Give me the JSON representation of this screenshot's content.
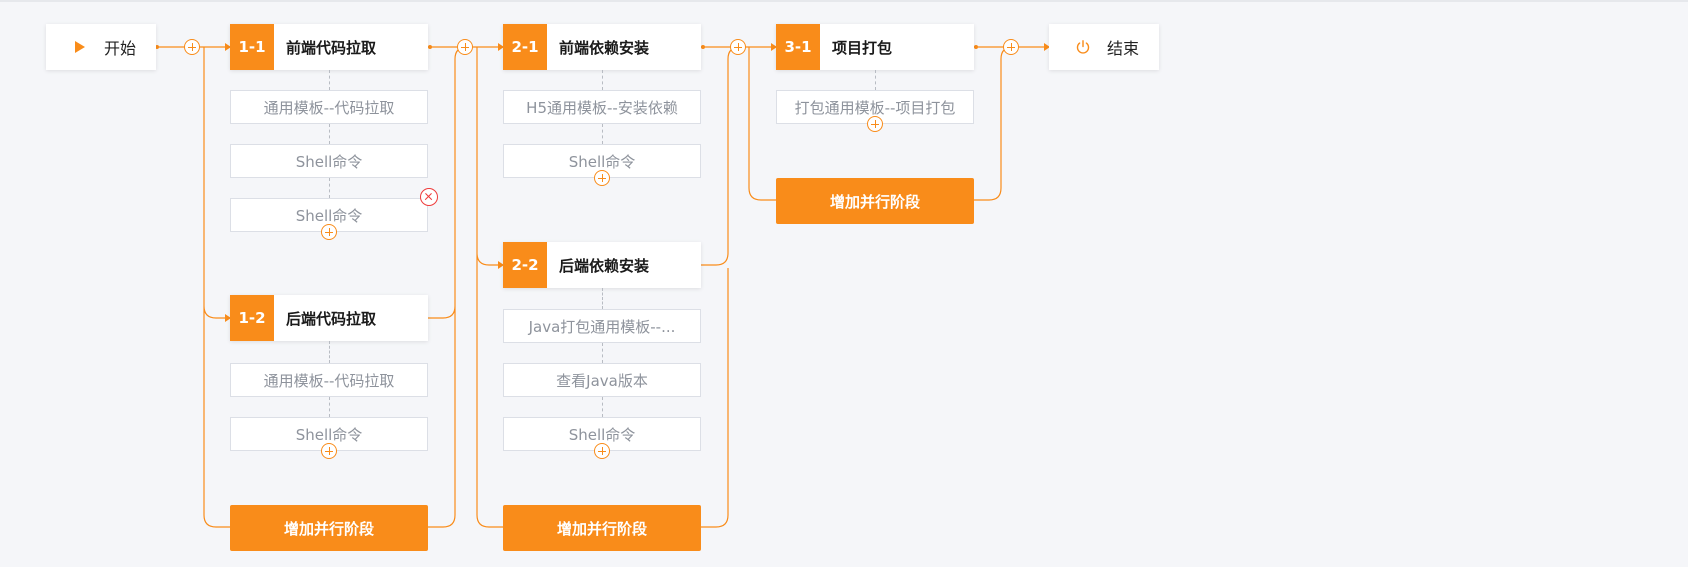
{
  "flow": {
    "start_label": "开始",
    "end_label": "结束",
    "add_parallel_label": "增加并行阶段",
    "accent_color": "#f98c1a",
    "danger_color": "#ee3b3b",
    "stages": [
      {
        "num": "1-1",
        "title": "前端代码拉取",
        "tasks": [
          "通用模板--代码拉取",
          "Shell命令",
          "Shell命令"
        ]
      },
      {
        "num": "1-2",
        "title": "后端代码拉取",
        "tasks": [
          "通用模板--代码拉取",
          "Shell命令"
        ]
      },
      {
        "num": "2-1",
        "title": "前端依赖安装",
        "tasks": [
          "H5通用模板--安装依赖",
          "Shell命令"
        ]
      },
      {
        "num": "2-2",
        "title": "后端依赖安装",
        "tasks": [
          "Java打包通用模板--...",
          "查看Java版本",
          "Shell命令"
        ]
      },
      {
        "num": "3-1",
        "title": "项目打包",
        "tasks": [
          "打包通用模板--项目打包"
        ]
      }
    ]
  }
}
